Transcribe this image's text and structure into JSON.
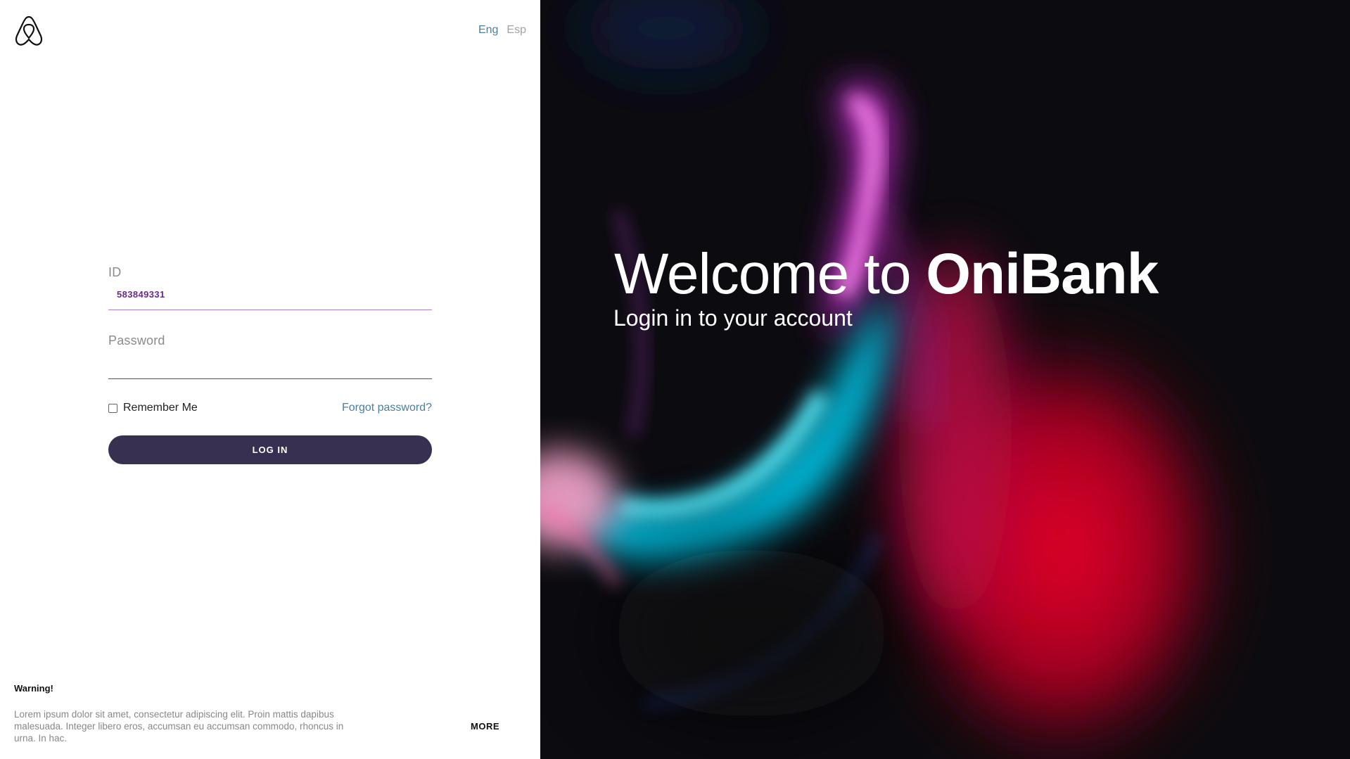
{
  "header": {
    "logo_icon": "airbnb-belo-icon",
    "languages": [
      {
        "label": "Eng",
        "active": true
      },
      {
        "label": "Esp",
        "active": false
      }
    ]
  },
  "form": {
    "id_label": "ID",
    "id_value": "583849331",
    "password_label": "Password",
    "password_value": "",
    "remember_label": "Remember Me",
    "remember_checked": false,
    "forgot_label": "Forgot password?",
    "login_label": "LOG IN"
  },
  "footer": {
    "warning_title": "Warning!",
    "warning_text": "Lorem ipsum dolor sit amet, consectetur adipiscing elit. Proin mattis dapibus malesuada. Integer libero eros, accumsan eu accumsan commodo, rhoncus in urna. In hac.",
    "more_label": "MORE"
  },
  "hero": {
    "welcome_prefix": "Welcome to ",
    "brand": "OniBank",
    "subtitle": "Login in to your account"
  },
  "colors": {
    "accent_link": "#4a7f9e",
    "button_bg": "#383051",
    "focus_underline": "#b47ec9",
    "id_text": "#6a2a8a",
    "hero_bg": "#0c0b10"
  }
}
